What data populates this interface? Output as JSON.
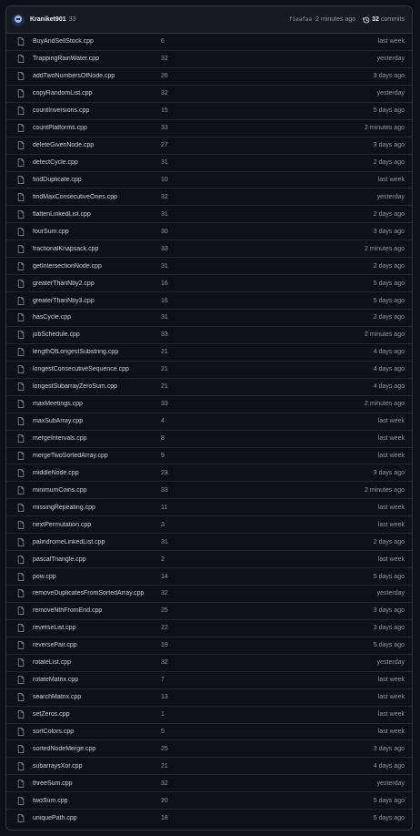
{
  "header": {
    "author": "Kraniket901",
    "message": "33",
    "sha": "f1eafaa",
    "time": "2 minutes ago",
    "commit_count": "32",
    "commits_label": "commits"
  },
  "files": [
    {
      "name": "BuyAndSellStock.cpp",
      "message": "6",
      "date": "last week"
    },
    {
      "name": "TrappingRainWater.cpp",
      "message": "32",
      "date": "yesterday"
    },
    {
      "name": "addTwoNumbersOfNode.cpp",
      "message": "26",
      "date": "3 days ago"
    },
    {
      "name": "copyRandomList.cpp",
      "message": "32",
      "date": "yesterday"
    },
    {
      "name": "countInversions.cpp",
      "message": "15",
      "date": "5 days ago"
    },
    {
      "name": "countPlatforms.cpp",
      "message": "33",
      "date": "2 minutes ago"
    },
    {
      "name": "deleteGivenNode.cpp",
      "message": "27",
      "date": "3 days ago"
    },
    {
      "name": "detectCycle.cpp",
      "message": "31",
      "date": "2 days ago"
    },
    {
      "name": "findDuplicate.cpp",
      "message": "10",
      "date": "last week"
    },
    {
      "name": "findMaxConsecutiveOnes.cpp",
      "message": "32",
      "date": "yesterday"
    },
    {
      "name": "flattenLinkedList.cpp",
      "message": "31",
      "date": "2 days ago"
    },
    {
      "name": "fourSum.cpp",
      "message": "30",
      "date": "3 days ago"
    },
    {
      "name": "fractionalKnapsack.cpp",
      "message": "33",
      "date": "2 minutes ago"
    },
    {
      "name": "getIntersectionNode.cpp",
      "message": "31",
      "date": "2 days ago"
    },
    {
      "name": "greaterThanNby2.cpp",
      "message": "16",
      "date": "5 days ago"
    },
    {
      "name": "greaterThanNby3.cpp",
      "message": "16",
      "date": "5 days ago"
    },
    {
      "name": "hasCycle.cpp",
      "message": "31",
      "date": "2 days ago"
    },
    {
      "name": "jobSchedule.cpp",
      "message": "33",
      "date": "2 minutes ago"
    },
    {
      "name": "lengthOfLongestSubstring.cpp",
      "message": "21",
      "date": "4 days ago"
    },
    {
      "name": "longestConsecutiveSequence.cpp",
      "message": "21",
      "date": "4 days ago"
    },
    {
      "name": "longestSubarrayZeroSum.cpp",
      "message": "21",
      "date": "4 days ago"
    },
    {
      "name": "maxMeetings.cpp",
      "message": "33",
      "date": "2 minutes ago"
    },
    {
      "name": "maxSubArray.cpp",
      "message": "4",
      "date": "last week"
    },
    {
      "name": "mergeIntervals.cpp",
      "message": "8",
      "date": "last week"
    },
    {
      "name": "mergeTwoSortedArray.cpp",
      "message": "9",
      "date": "last week"
    },
    {
      "name": "middleNode.cpp",
      "message": "23",
      "date": "3 days ago"
    },
    {
      "name": "minimumCoins.cpp",
      "message": "33",
      "date": "2 minutes ago"
    },
    {
      "name": "missingRepeating.cpp",
      "message": "11",
      "date": "last week"
    },
    {
      "name": "nextPermutation.cpp",
      "message": "3",
      "date": "last week"
    },
    {
      "name": "palindromeLinkedList.cpp",
      "message": "31",
      "date": "2 days ago"
    },
    {
      "name": "pascalTriangle.cpp",
      "message": "2",
      "date": "last week"
    },
    {
      "name": "pow.cpp",
      "message": "14",
      "date": "5 days ago"
    },
    {
      "name": "removeDuplicatesFromSortedArray.cpp",
      "message": "32",
      "date": "yesterday"
    },
    {
      "name": "removeNthFromEnd.cpp",
      "message": "25",
      "date": "3 days ago"
    },
    {
      "name": "reverseList.cpp",
      "message": "22",
      "date": "3 days ago"
    },
    {
      "name": "reversePair.cpp",
      "message": "19",
      "date": "5 days ago"
    },
    {
      "name": "rotateList.cpp",
      "message": "32",
      "date": "yesterday"
    },
    {
      "name": "rotateMatrix.cpp",
      "message": "7",
      "date": "last week"
    },
    {
      "name": "searchMatrix.cpp",
      "message": "13",
      "date": "last week"
    },
    {
      "name": "setZeros.cpp",
      "message": "1",
      "date": "last week"
    },
    {
      "name": "sortColors.cpp",
      "message": "5",
      "date": "last week"
    },
    {
      "name": "sortedNodeMerge.cpp",
      "message": "25",
      "date": "3 days ago"
    },
    {
      "name": "subarraysXor.cpp",
      "message": "21",
      "date": "4 days ago"
    },
    {
      "name": "threeSum.cpp",
      "message": "32",
      "date": "yesterday"
    },
    {
      "name": "twoSum.cpp",
      "message": "20",
      "date": "5 days ago"
    },
    {
      "name": "uniquePath.cpp",
      "message": "18",
      "date": "5 days ago"
    }
  ]
}
